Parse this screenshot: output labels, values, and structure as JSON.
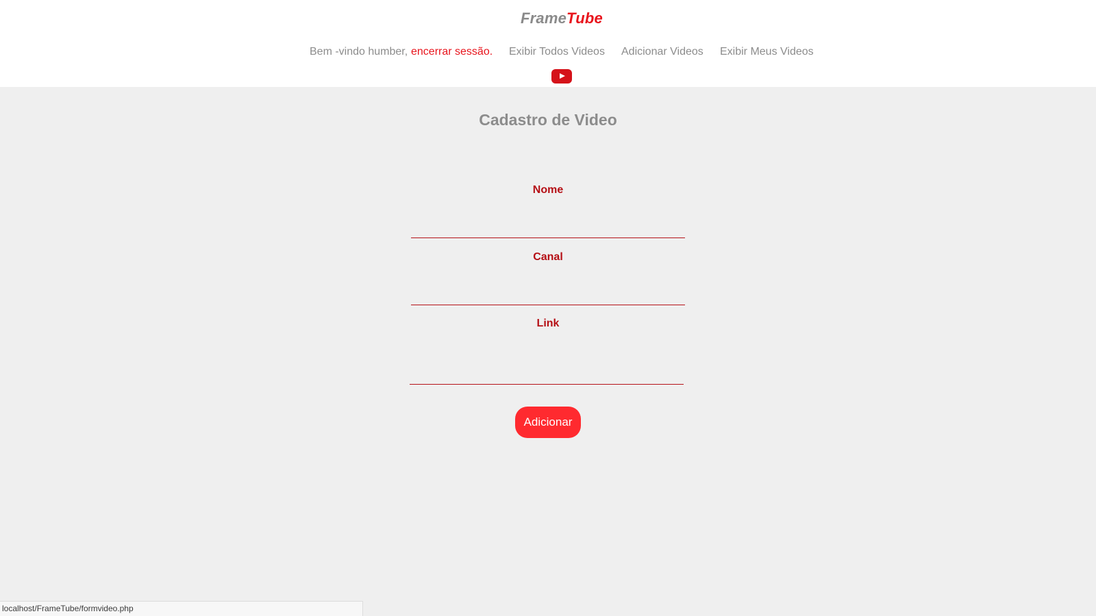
{
  "header": {
    "logo_part1": "Frame",
    "logo_part2": "Tube",
    "welcome": "Bem -vindo humber,",
    "logout": "encerrar sessão.",
    "nav_all_videos": "Exibir Todos Videos",
    "nav_add_videos": "Adicionar Videos",
    "nav_my_videos": "Exibir Meus Videos",
    "icon": "youtube-play-icon"
  },
  "form": {
    "title": "Cadastro de Video",
    "name_label": "Nome",
    "name_value": "",
    "channel_label": "Canal",
    "channel_value": "",
    "link_label": "Link",
    "link_value": "",
    "submit_label": "Adicionar"
  },
  "status_bar": {
    "url": "localhost/FrameTube/formvideo.php"
  },
  "colors": {
    "accent_red": "#e8141c",
    "button_red": "#ff2a2f",
    "label_dark_red": "#b50f15",
    "muted_gray": "#8c8c8c",
    "page_background": "#efefef"
  }
}
